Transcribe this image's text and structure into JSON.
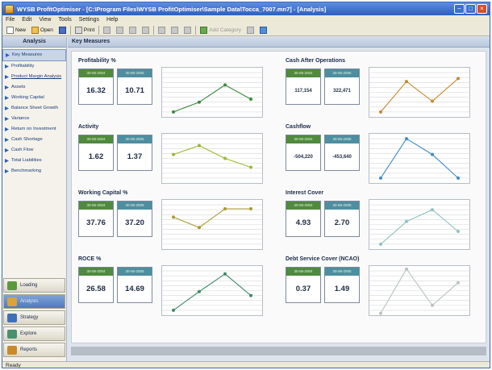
{
  "window": {
    "title": "WYSB ProfitOptimiser - [C:\\Program Files\\WYSB ProfitOptimiser\\Sample Data\\Tocca_7007.mn7] - [Analysis]"
  },
  "menu": [
    "File",
    "Edit",
    "View",
    "Tools",
    "Settings",
    "Help"
  ],
  "toolbar": {
    "new_label": "New",
    "open_label": "Open",
    "print_label": "Print",
    "options_label": "Add Category"
  },
  "sidebar": {
    "header": "Analysis",
    "items": [
      {
        "label": "Key Measures",
        "active": true
      },
      {
        "label": "Profitability"
      },
      {
        "label": "Product Margin Analysis"
      },
      {
        "label": "Assets"
      },
      {
        "label": "Working Capital"
      },
      {
        "label": "Balance Sheet Growth"
      },
      {
        "label": "Variance"
      },
      {
        "label": "Return on Investment"
      },
      {
        "label": "Cash Shortage"
      },
      {
        "label": "Cash Flow"
      },
      {
        "label": "Total Liabilities"
      },
      {
        "label": "Benchmarking"
      }
    ],
    "nav": [
      {
        "label": "Loading",
        "color": "#5b9a3c"
      },
      {
        "label": "Analysis",
        "color": "#d9a33a",
        "selected": true
      },
      {
        "label": "Strategy",
        "color": "#3f6fb8"
      },
      {
        "label": "Explore",
        "color": "#4a8f6e"
      },
      {
        "label": "Reports",
        "color": "#c98a2a"
      }
    ]
  },
  "main": {
    "title": "Key Measures",
    "date_a": "30-06-2004",
    "date_b": "30-06-2005",
    "metrics": [
      {
        "title": "Profitability %",
        "value_a": "16.32",
        "value_b": "10.71",
        "color": "#3b8a3b",
        "points": [
          1.0,
          3.0,
          6.5,
          3.6
        ]
      },
      {
        "title": "Cash After Operations",
        "value_a": "117,154",
        "value_b": "322,471",
        "color": "#c8892a",
        "points": [
          1.0,
          7.2,
          3.2,
          7.8
        ]
      },
      {
        "title": "Activity",
        "value_a": "1.62",
        "value_b": "1.37",
        "color": "#9aba2e",
        "points": [
          5.8,
          7.6,
          5.0,
          3.2
        ]
      },
      {
        "title": "Cashflow",
        "value_a": "-504,220",
        "value_b": "-453,640",
        "color": "#3f8ac6",
        "points": [
          1.0,
          9.0,
          5.8,
          1.0
        ]
      },
      {
        "title": "Working Capital %",
        "value_a": "37.76",
        "value_b": "37.20",
        "color": "#a89a2e",
        "points": [
          6.5,
          4.4,
          8.2,
          8.2
        ]
      },
      {
        "title": "Interest Cover",
        "value_a": "4.93",
        "value_b": "2.70",
        "color": "#8ec2c0",
        "points": [
          1.0,
          5.6,
          8.0,
          3.6
        ]
      },
      {
        "title": "ROCE %",
        "value_a": "26.58",
        "value_b": "14.69",
        "color": "#3f8a6a",
        "points": [
          1.0,
          4.8,
          8.4,
          4.0
        ]
      },
      {
        "title": "Debt Service Cover (NCAO)",
        "value_a": "0.37",
        "value_b": "1.49",
        "color": "#b8c4c0",
        "points": [
          0.4,
          9.4,
          2.0,
          6.6
        ]
      }
    ]
  },
  "statusbar": {
    "text": "Ready"
  }
}
